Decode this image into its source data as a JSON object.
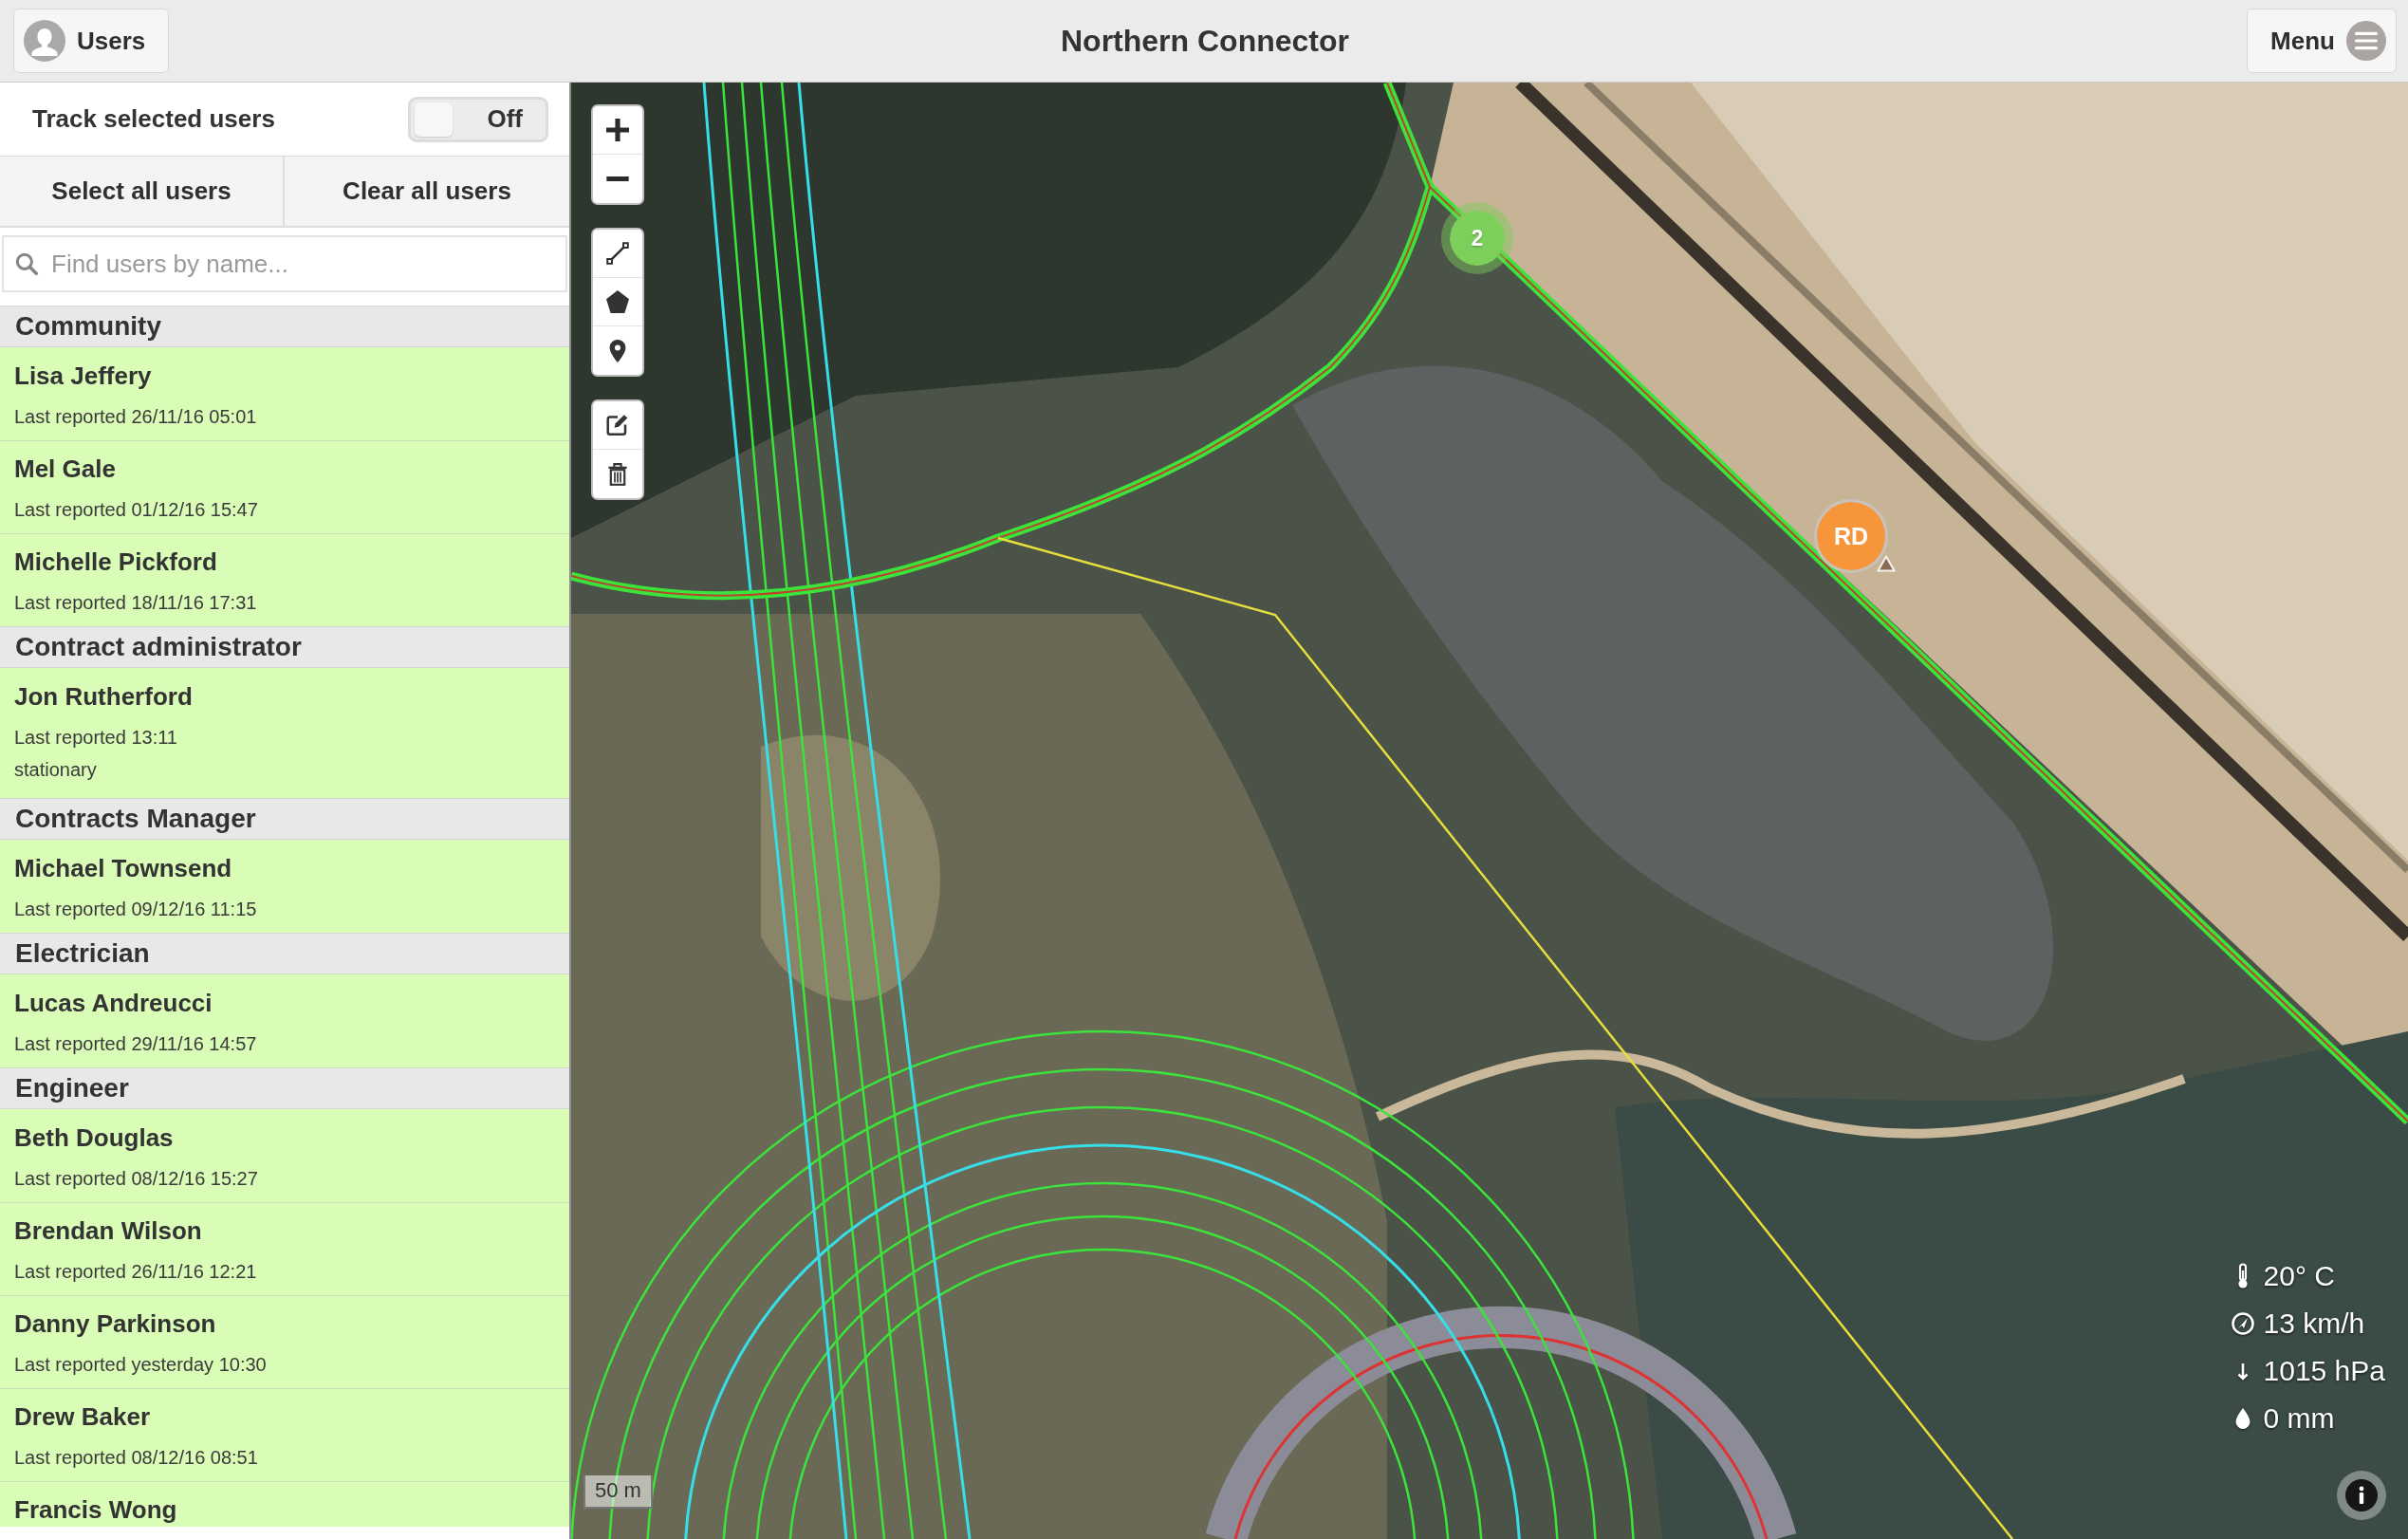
{
  "header": {
    "users_button": "Users",
    "title": "Northern Connector",
    "menu_button": "Menu"
  },
  "sidebar": {
    "track": {
      "label": "Track selected users",
      "on": false,
      "state_text": "Off"
    },
    "actions": [
      "Select all users",
      "Clear all users"
    ],
    "search": {
      "placeholder": "Find users by name..."
    },
    "groups": [
      {
        "name": "Community",
        "users": [
          {
            "name": "Lisa Jeffery",
            "reported": "Last reported 26/11/16 05:01"
          },
          {
            "name": "Mel Gale",
            "reported": "Last reported 01/12/16 15:47"
          },
          {
            "name": "Michelle Pickford",
            "reported": "Last reported 18/11/16 17:31"
          }
        ]
      },
      {
        "name": "Contract administrator",
        "users": [
          {
            "name": "Jon Rutherford",
            "reported": "Last reported 13:11",
            "status": "stationary"
          }
        ]
      },
      {
        "name": "Contracts Manager",
        "users": [
          {
            "name": "Michael Townsend",
            "reported": "Last reported 09/12/16 11:15"
          }
        ]
      },
      {
        "name": "Electrician",
        "users": [
          {
            "name": "Lucas Andreucci",
            "reported": "Last reported 29/11/16 14:57"
          }
        ]
      },
      {
        "name": "Engineer",
        "users": [
          {
            "name": "Beth Douglas",
            "reported": "Last reported 08/12/16 15:27"
          },
          {
            "name": "Brendan Wilson",
            "reported": "Last reported 26/11/16 12:21"
          },
          {
            "name": "Danny Parkinson",
            "reported": "Last reported yesterday 10:30"
          },
          {
            "name": "Drew Baker",
            "reported": "Last reported 08/12/16 08:51"
          },
          {
            "name": "Francis Wong"
          }
        ]
      }
    ]
  },
  "map": {
    "markers": [
      {
        "kind": "cluster",
        "label": "2",
        "color": "#7dcf5b"
      },
      {
        "kind": "user",
        "label": "RD",
        "color": "#f7953b"
      }
    ],
    "weather": [
      {
        "kind": "temperature",
        "text": "20° C"
      },
      {
        "kind": "wind",
        "text": "13 km/h"
      },
      {
        "kind": "pressure",
        "text": "1015 hPa"
      },
      {
        "kind": "rain",
        "text": "0 mm"
      }
    ],
    "scale": "50 m"
  }
}
